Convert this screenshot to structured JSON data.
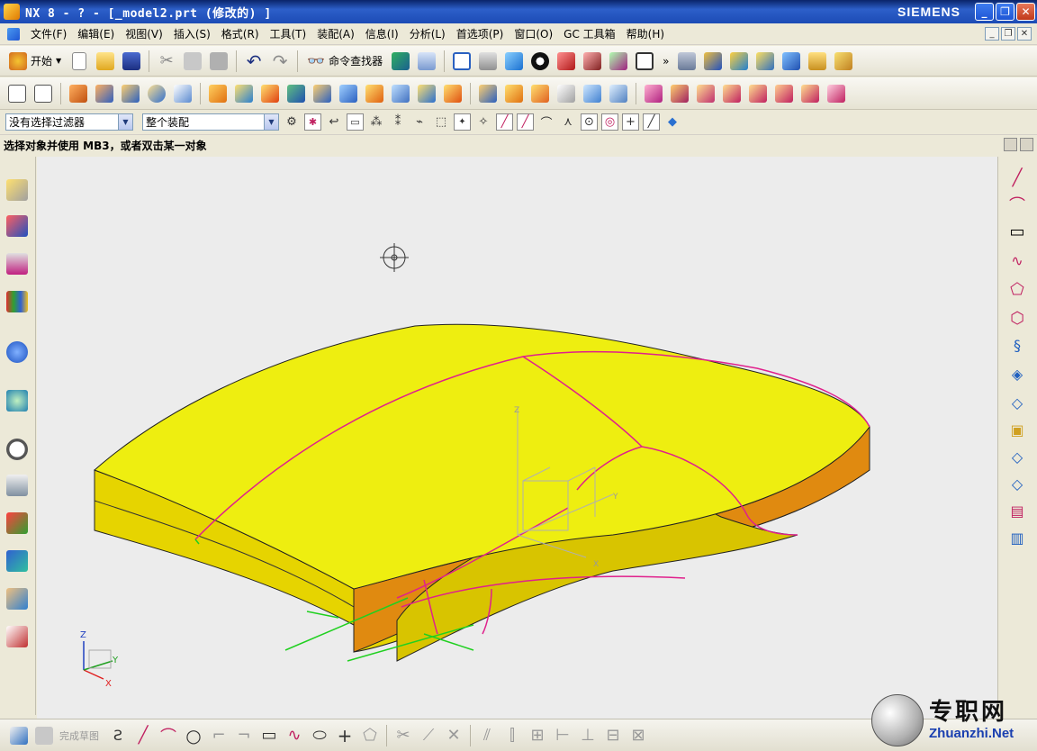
{
  "window": {
    "title": "NX 8 - ? - [_model2.prt  (修改的) ]",
    "brand": "SIEMENS",
    "controls": [
      "_",
      "❐",
      "✕"
    ]
  },
  "menubar": {
    "items": [
      "文件(F)",
      "编辑(E)",
      "视图(V)",
      "插入(S)",
      "格式(R)",
      "工具(T)",
      "装配(A)",
      "信息(I)",
      "分析(L)",
      "首选项(P)",
      "窗口(O)",
      "GC 工具箱",
      "帮助(H)"
    ]
  },
  "toolbar1": {
    "start_label": "开始",
    "command_finder_label": "命令查找器",
    "more_glyph": "»"
  },
  "selection_bar": {
    "filter_value": "没有选择过滤器",
    "scope_value": "整个装配"
  },
  "prompt": {
    "text": "选择对象并使用 MB3，或者双击某一对象"
  },
  "bottombar": {
    "finish_sketch_label": "完成草图"
  },
  "viewport": {
    "axis_labels": {
      "x": "X",
      "y": "Y",
      "z": "Z"
    },
    "colors": {
      "background": "#ececec",
      "model_top": "#eeee10",
      "model_side": "#e08a10",
      "edge_curve": "#e0208c",
      "sketch_line": "#20d020"
    }
  },
  "watermark": {
    "cn": "专职网",
    "en": "Zhuanzhi.Net"
  }
}
